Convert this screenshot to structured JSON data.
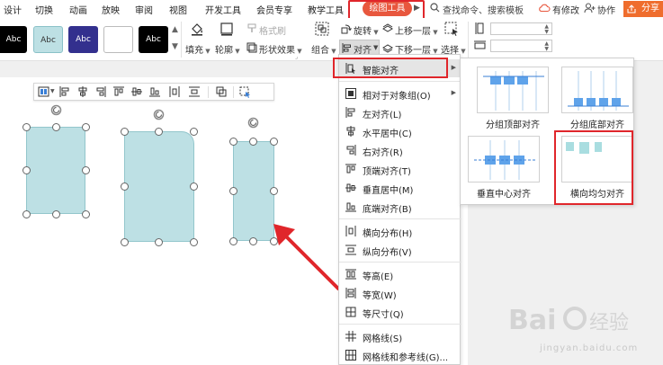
{
  "tabs": [
    "设计",
    "切换",
    "动画",
    "放映",
    "审阅",
    "视图",
    "开发工具",
    "会员专享",
    "教学工具"
  ],
  "active_tab": "绘图工具",
  "search_placeholder": "查找命令、搜索模板",
  "header_right": {
    "changes": "有修改",
    "collab": "协作",
    "share": "分享"
  },
  "ribbon": {
    "styles": [
      "Abc",
      "Abc",
      "Abc",
      "",
      "Abc"
    ],
    "fill": "填充",
    "outline": "轮廓",
    "format_brush": "格式刷",
    "shape_effects": "形状效果",
    "group": "组合",
    "rotate": "旋转",
    "align": "对齐",
    "bring_forward": "上移一层",
    "send_backward": "下移一层",
    "select": "选择"
  },
  "dropdown": {
    "smart_align": "智能对齐",
    "items": [
      {
        "label": "相对于对象组(O)",
        "submenu": true
      },
      {
        "label": "左对齐(L)"
      },
      {
        "label": "水平居中(C)"
      },
      {
        "label": "右对齐(R)"
      },
      {
        "label": "顶端对齐(T)"
      },
      {
        "label": "垂直居中(M)"
      },
      {
        "label": "底端对齐(B)"
      },
      {
        "label": "横向分布(H)"
      },
      {
        "label": "纵向分布(V)"
      },
      {
        "label": "等高(E)"
      },
      {
        "label": "等宽(W)"
      },
      {
        "label": "等尺寸(Q)"
      },
      {
        "label": "网格线(S)"
      },
      {
        "label": "网格线和参考线(G)..."
      }
    ]
  },
  "submenu": {
    "options": [
      "分组顶部对齐",
      "分组底部对齐",
      "垂直中心对齐",
      "横向均匀对齐"
    ]
  },
  "colors": {
    "accent": "#e8573e",
    "highlight": "#e0262b",
    "shape_fill": "#bde0e4",
    "share": "#ef6d2d"
  }
}
